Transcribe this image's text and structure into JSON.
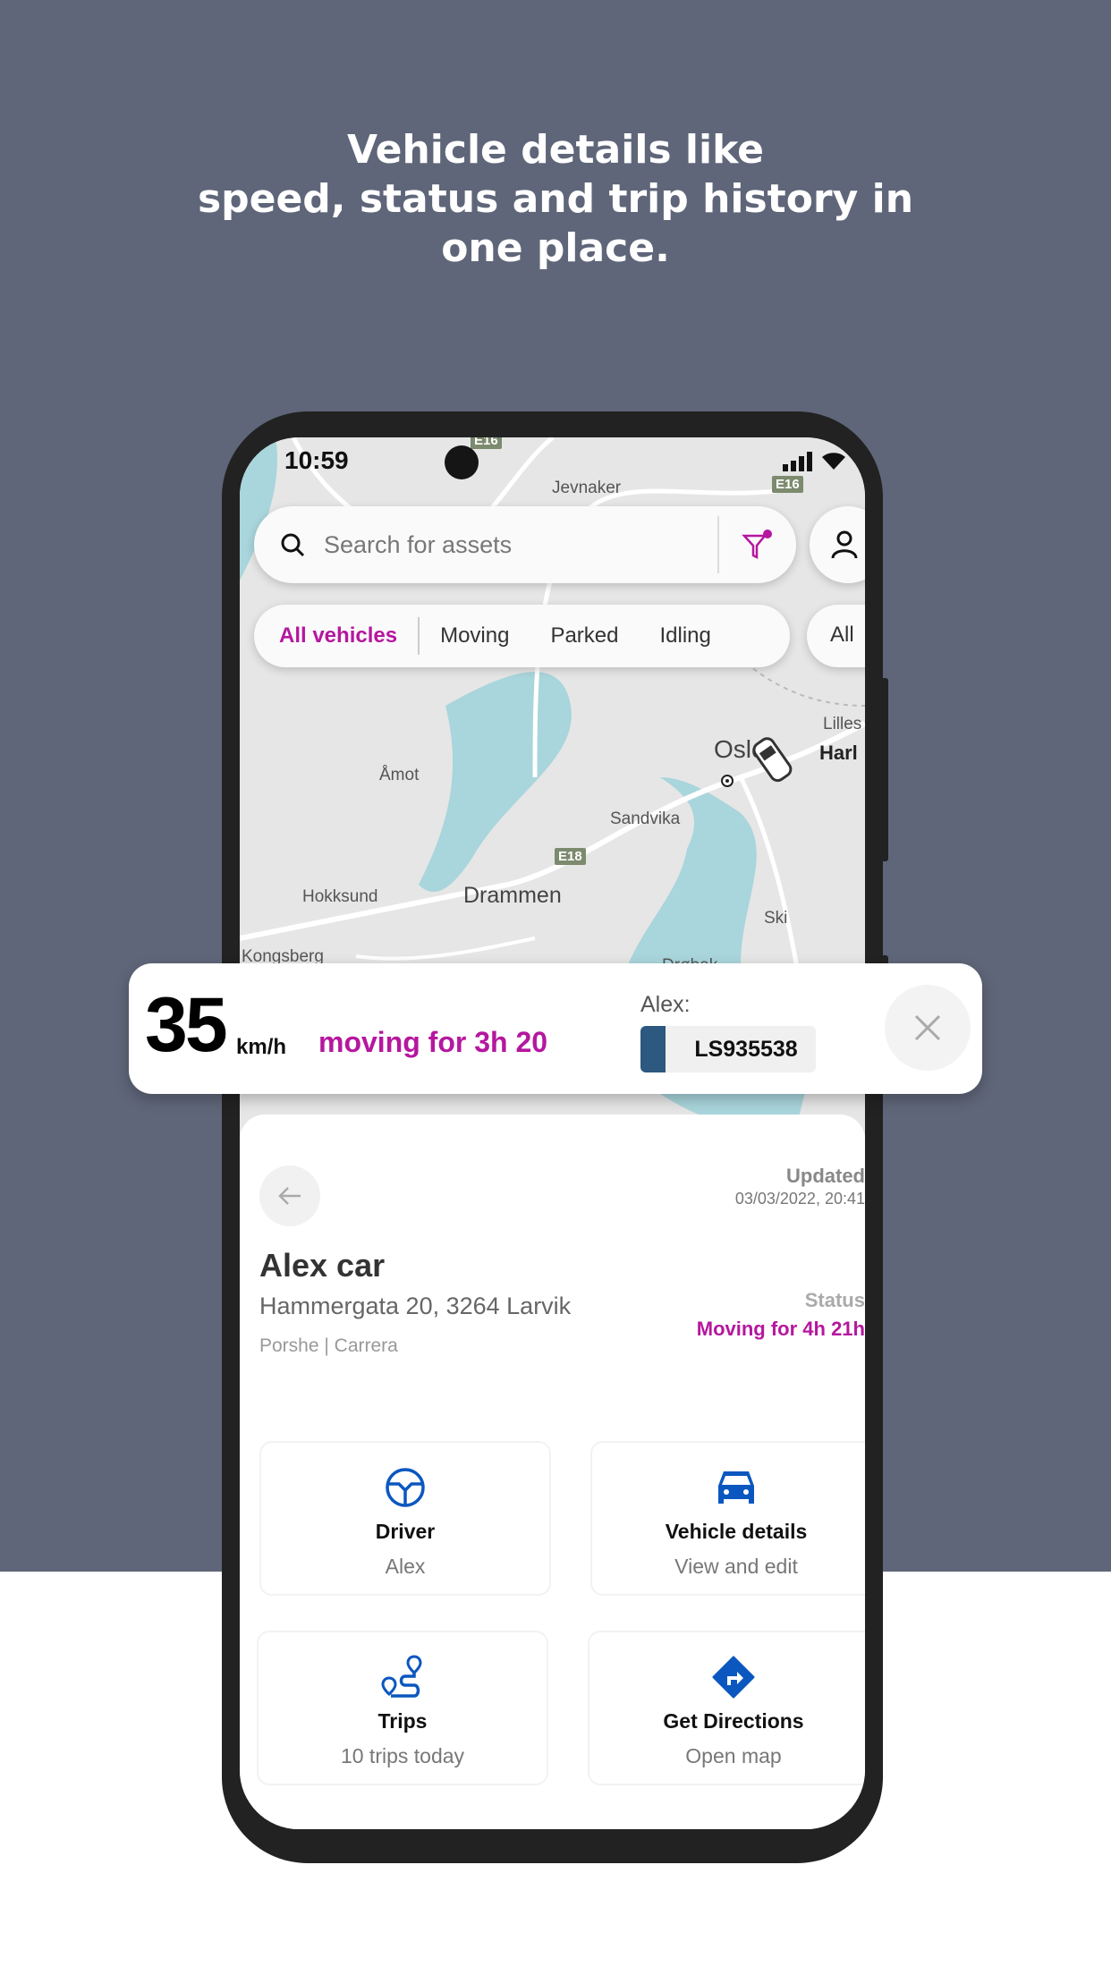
{
  "headline": {
    "line1": "Vehicle details like",
    "line2": "speed, status and trip history in",
    "line3": "one place."
  },
  "status_bar": {
    "time": "10:59"
  },
  "map": {
    "labels": [
      "Jevnaker",
      "Lilles",
      "Harl",
      "Oslo",
      "Åmot",
      "Sandvika",
      "Drammen",
      "Hokksund",
      "Ski",
      "Kongsberg",
      "Drøbak"
    ],
    "shields": [
      "E16",
      "E16",
      "E18"
    ],
    "colors": {
      "land": "#e6e6e6",
      "water": "#a9d5dc",
      "road": "#ffffff"
    }
  },
  "search": {
    "placeholder": "Search for assets",
    "icon": "search-icon",
    "filter_icon": "filter-icon",
    "filter_active": true
  },
  "profile_icon": "user-icon",
  "chips": [
    {
      "label": "All vehicles",
      "active": true
    },
    {
      "label": "Moving"
    },
    {
      "label": "Parked"
    },
    {
      "label": "Idling"
    }
  ],
  "chips2": {
    "label": "All"
  },
  "speed_card": {
    "speed": "35",
    "unit": "km/h",
    "moving": "moving for 3h 20",
    "driver_label": "Alex:",
    "plate": "LS935538",
    "plate_color": "#2d5880"
  },
  "vehicle": {
    "updated_label": "Updated",
    "updated_value": "03/03/2022, 20:41",
    "name": "Alex car",
    "address": "Hammergata 20, 3264 Larvik",
    "model": "Porshe | Carrera",
    "status_label": "Status",
    "status_value": "Moving for 4h 21h"
  },
  "cards": [
    {
      "icon": "steering-wheel-icon",
      "title": "Driver",
      "subtitle": "Alex"
    },
    {
      "icon": "car-icon",
      "title": "Vehicle details",
      "subtitle": "View and edit"
    },
    {
      "icon": "route-icon",
      "title": "Trips",
      "subtitle": "10 trips today"
    },
    {
      "icon": "directions-icon",
      "title": "Get Directions",
      "subtitle": "Open map"
    }
  ],
  "colors": {
    "accent": "#b5179e",
    "icon_blue": "#0b57c0",
    "background": "#5f6679"
  }
}
